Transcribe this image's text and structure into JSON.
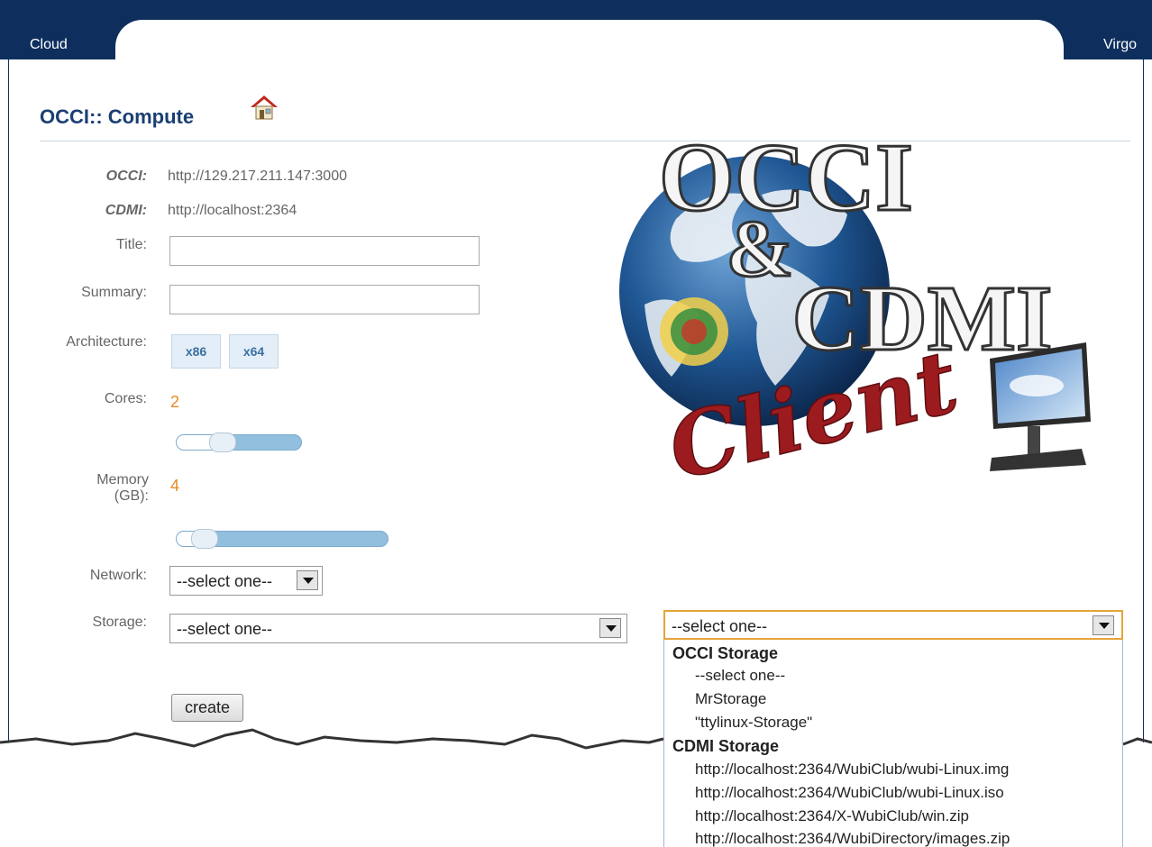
{
  "nav": {
    "left_tab": "Cloud",
    "right_tab": "Virgo"
  },
  "page": {
    "title": "OCCI:: Compute",
    "home_icon": "home-icon"
  },
  "logo": {
    "line1": "OCCI",
    "amp": "&",
    "line2": "CDMI",
    "script": "Client"
  },
  "endpoints": [
    {
      "label": "OCCI:",
      "value": "http://129.217.211.147:3000"
    },
    {
      "label": "CDMI:",
      "value": "http://localhost:2364"
    }
  ],
  "form": {
    "title_label": "Title:",
    "title_value": "",
    "summary_label": "Summary:",
    "summary_value": "",
    "architecture_label": "Architecture:",
    "architecture_options": [
      "x86",
      "x64"
    ],
    "cores_label": "Cores:",
    "cores_value": "2",
    "cores_slider_fraction": 0.33,
    "memory_label_line1": "Memory",
    "memory_label_line2": "(GB):",
    "memory_value": "4",
    "memory_slider_fraction": 0.08,
    "network_label": "Network:",
    "network_selected": "--select one--",
    "storage_label": "Storage:",
    "storage_selected": "--select one--",
    "storage_secondary_selected": "--select one--",
    "create_label": "create"
  },
  "storage_dropdown": {
    "groups": [
      {
        "name": "OCCI Storage",
        "options": [
          "--select one--",
          "MrStorage",
          "\"ttylinux-Storage\""
        ]
      },
      {
        "name": "CDMI Storage",
        "options": [
          "http://localhost:2364/WubiClub/wubi-Linux.img",
          "http://localhost:2364/WubiClub/wubi-Linux.iso",
          "http://localhost:2364/X-WubiClub/win.zip",
          "http://localhost:2364/WubiDirectory/images.zip"
        ]
      }
    ]
  },
  "colors": {
    "navy": "#0e2f5e",
    "title_blue": "#1a3f74",
    "accent_orange": "#e48a26",
    "slider_blue": "#93bfde"
  }
}
